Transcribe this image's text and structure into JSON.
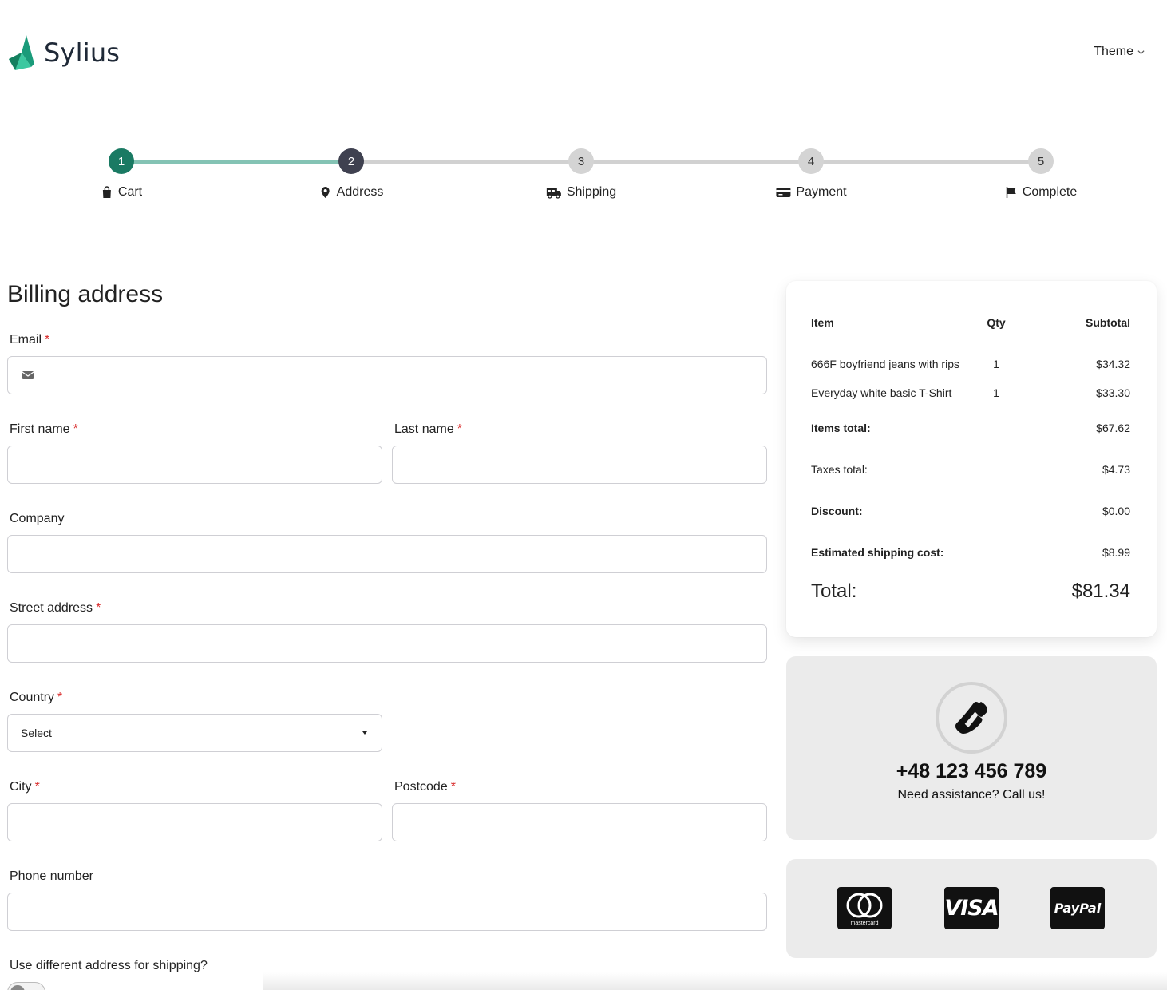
{
  "header": {
    "brand": "Sylius",
    "theme_label": "Theme"
  },
  "steps": [
    {
      "number": "1",
      "label": "Cart",
      "icon": "shopping-bag-icon"
    },
    {
      "number": "2",
      "label": "Address",
      "icon": "map-pin-icon"
    },
    {
      "number": "3",
      "label": "Shipping",
      "icon": "truck-icon"
    },
    {
      "number": "4",
      "label": "Payment",
      "icon": "credit-card-icon"
    },
    {
      "number": "5",
      "label": "Complete",
      "icon": "flag-icon"
    }
  ],
  "form": {
    "title": "Billing address",
    "email_label": "Email",
    "first_name_label": "First name",
    "last_name_label": "Last name",
    "company_label": "Company",
    "street_label": "Street address",
    "country_label": "Country",
    "country_value": "Select",
    "city_label": "City",
    "postcode_label": "Postcode",
    "phone_label": "Phone number",
    "different_shipping_label": "Use different address for shipping?",
    "required_marker": "*"
  },
  "summary": {
    "headers": {
      "item": "Item",
      "qty": "Qty",
      "subtotal": "Subtotal"
    },
    "items": [
      {
        "name": "666F boyfriend jeans with rips",
        "qty": "1",
        "subtotal": "$34.32"
      },
      {
        "name": "Everyday white basic T-Shirt",
        "qty": "1",
        "subtotal": "$33.30"
      }
    ],
    "items_total_label": "Items total:",
    "items_total": "$67.62",
    "taxes_label": "Taxes total:",
    "taxes": "$4.73",
    "discount_label": "Discount:",
    "discount": "$0.00",
    "shipping_label": "Estimated shipping cost:",
    "shipping": "$8.99",
    "total_label": "Total:",
    "total": "$81.34"
  },
  "help": {
    "phone": "+48 123 456 789",
    "text": "Need assistance? Call us!"
  },
  "payments": {
    "mastercard_label": "mastercard",
    "visa_label": "VISA",
    "paypal_label": "PayPal"
  },
  "colors": {
    "accent": "#1a7a63",
    "current_step": "#3f4150",
    "progress_done": "#84c3b4",
    "required": "#d92b2b"
  }
}
